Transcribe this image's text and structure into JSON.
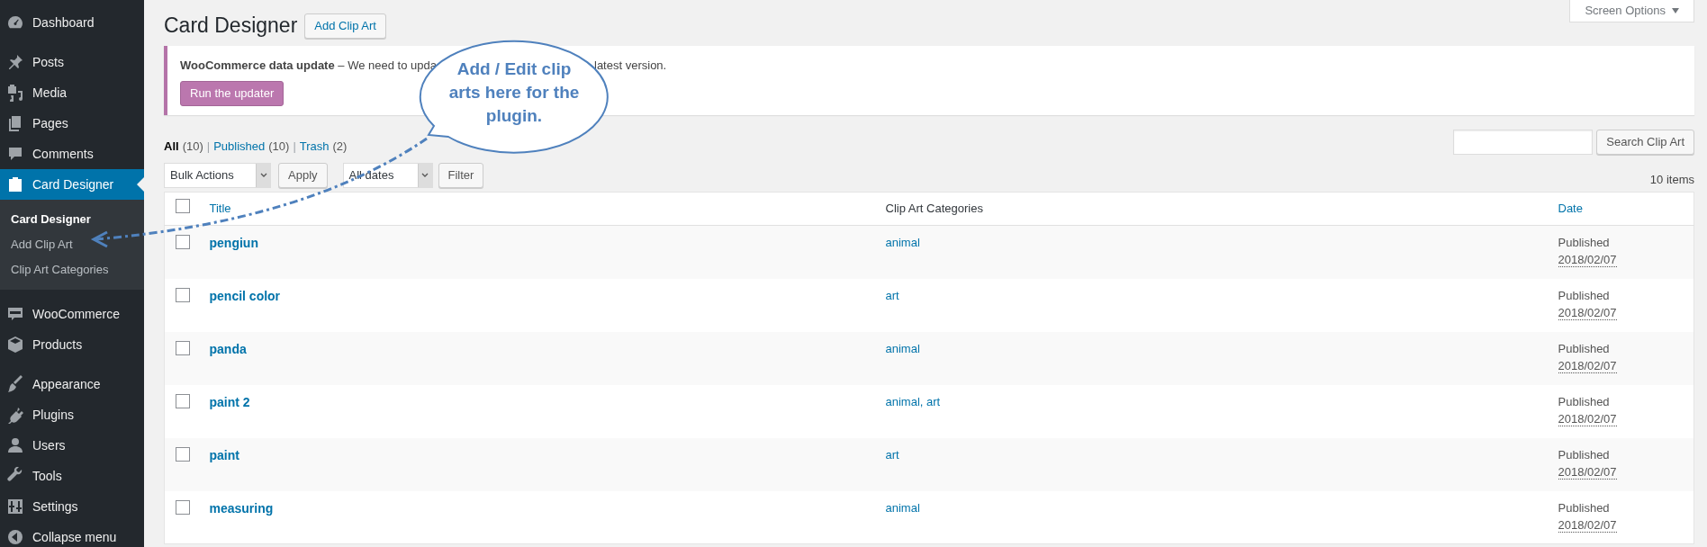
{
  "sidebar": {
    "groups": [
      {
        "items": [
          {
            "label": "Dashboard",
            "selected": false
          }
        ]
      },
      {
        "items": [
          {
            "label": "Posts",
            "selected": false
          },
          {
            "label": "Media",
            "selected": false
          },
          {
            "label": "Pages",
            "selected": false
          },
          {
            "label": "Comments",
            "selected": false
          },
          {
            "label": "Card Designer",
            "selected": true,
            "expanded": true,
            "children": [
              {
                "label": "Card Designer",
                "selected": true
              },
              {
                "label": "Add Clip Art",
                "selected": false
              },
              {
                "label": "Clip Art Categories",
                "selected": false
              }
            ]
          }
        ]
      },
      {
        "items": [
          {
            "label": "WooCommerce",
            "selected": false
          },
          {
            "label": "Products",
            "selected": false
          }
        ]
      },
      {
        "items": [
          {
            "label": "Appearance",
            "selected": false
          },
          {
            "label": "Plugins",
            "selected": false
          },
          {
            "label": "Users",
            "selected": false
          },
          {
            "label": "Tools",
            "selected": false
          },
          {
            "label": "Settings",
            "selected": false
          },
          {
            "label": "Collapse menu",
            "selected": false
          }
        ]
      }
    ]
  },
  "page": {
    "title": "Card Designer",
    "add_button": "Add Clip Art",
    "screen_options": "Screen Options"
  },
  "notice": {
    "text_before": "**WooCommerce data update** – We need to upda",
    "text_after": "latest version.",
    "button": "Run the updater"
  },
  "callout": {
    "text": "Add / Edit clip arts here for the plugin."
  },
  "filters": {
    "separator": "|",
    "items": [
      {
        "label": "All",
        "count": "(10)",
        "selected": true
      },
      {
        "label": "Published",
        "count": "(10)",
        "selected": false
      },
      {
        "label": "Trash",
        "count": "(2)",
        "selected": false
      }
    ]
  },
  "search": {
    "button": "Search Clip Art"
  },
  "tablenav": {
    "bulk_actions": "Bulk Actions",
    "apply": "Apply",
    "dates": "All dates",
    "filter": "Filter",
    "count": "10 items"
  },
  "table": {
    "select_all_checked": false,
    "columns": [
      "Title",
      "Clip Art Categories",
      "Date"
    ],
    "rows": [
      {
        "title": "pengiun",
        "categories": "animal",
        "status": "Published",
        "date": "2018/02/07",
        "checked": false
      },
      {
        "title": "pencil color",
        "categories": "art",
        "status": "Published",
        "date": "2018/02/07",
        "checked": false
      },
      {
        "title": "panda",
        "categories": "animal",
        "status": "Published",
        "date": "2018/02/07",
        "checked": false
      },
      {
        "title": "paint 2",
        "categories": "animal, art",
        "status": "Published",
        "date": "2018/02/07",
        "checked": false
      },
      {
        "title": "paint",
        "categories": "art",
        "status": "Published",
        "date": "2018/02/07",
        "checked": false
      },
      {
        "title": "measuring",
        "categories": "animal",
        "status": "Published",
        "date": "2018/02/07",
        "checked": false
      }
    ]
  }
}
